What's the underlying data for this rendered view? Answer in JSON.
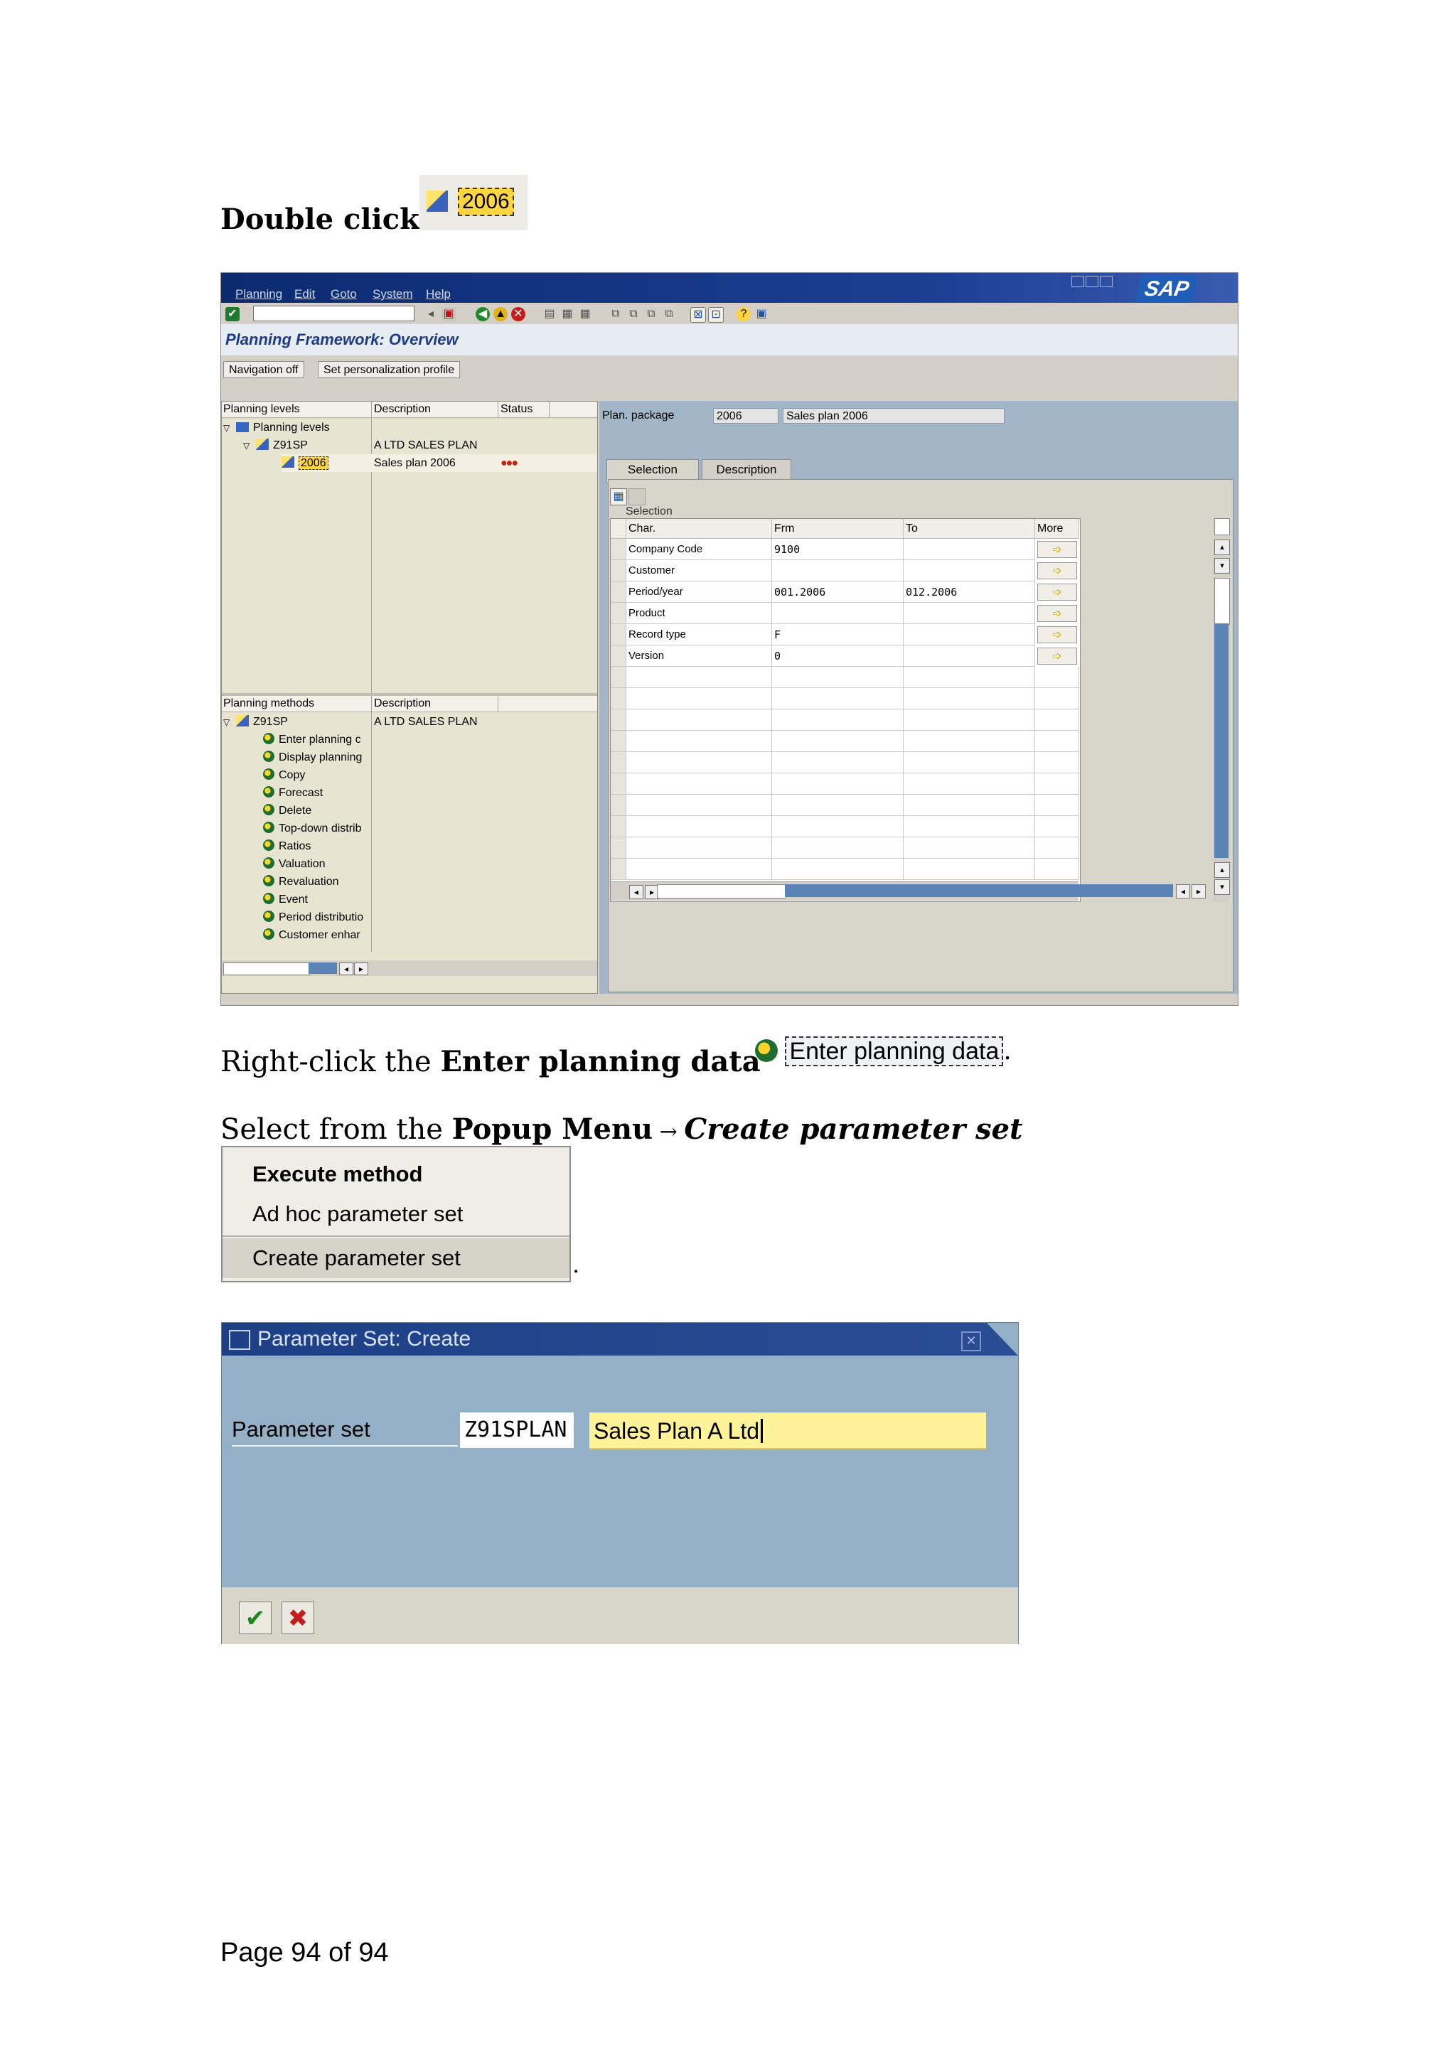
{
  "doc": {
    "step1_lead": "Double click",
    "step1_inline_label": "2006",
    "step2_prefix": "Right-click the ",
    "step2_bold": "Enter planning data",
    "step2_inline_label": "Enter planning data",
    "step2_suffix": ".",
    "step3_prefix": "Select from the ",
    "step3_bold": "Popup Menu",
    "step3_arrow": " → ",
    "step3_bold_italic": "Create parameter set",
    "menu_trailing_dot": ".",
    "footer": "Page 94 of 94"
  },
  "sap": {
    "menu": [
      "Planning",
      "Edit",
      "Goto",
      "System",
      "Help"
    ],
    "logo": "SAP",
    "screen_title": "Planning Framework: Overview",
    "app_buttons": [
      "Navigation off",
      "Set personalization profile"
    ],
    "levels_headers": [
      "Planning levels",
      "Description",
      "Status"
    ],
    "levels_rows": [
      {
        "name": "Planning levels",
        "desc": "",
        "status": ""
      },
      {
        "name": "Z91SP",
        "desc": "A LTD SALES PLAN",
        "status": ""
      },
      {
        "name": "2006",
        "desc": "Sales plan 2006",
        "status": "●●●"
      }
    ],
    "methods_headers": [
      "Planning methods",
      "Description"
    ],
    "methods_root": {
      "name": "Z91SP",
      "desc": "A LTD SALES PLAN"
    },
    "methods": [
      "Enter planning c",
      "Display planning",
      "Copy",
      "Forecast",
      "Delete",
      "Top-down distrib",
      "Ratios",
      "Valuation",
      "Revaluation",
      "Event",
      "Period distributio",
      "Customer enhar"
    ],
    "plan_package_label": "Plan. package",
    "plan_package_value": "2006",
    "plan_package_desc": "Sales plan 2006",
    "tabs": [
      "Selection",
      "Description"
    ],
    "selection_caption": "Selection",
    "grid_headers": [
      "Char.",
      "Frm",
      "To",
      "More"
    ],
    "grid_rows": [
      {
        "char": "Company Code",
        "from": "9100",
        "to": ""
      },
      {
        "char": "Customer",
        "from": "",
        "to": ""
      },
      {
        "char": "Period/year",
        "from": "001.2006",
        "to": "012.2006"
      },
      {
        "char": "Product",
        "from": "",
        "to": ""
      },
      {
        "char": "Record type",
        "from": "F",
        "to": ""
      },
      {
        "char": "Version",
        "from": "0",
        "to": ""
      }
    ]
  },
  "popup_menu": {
    "items": [
      "Execute method",
      "Ad hoc parameter set",
      "Create parameter set"
    ]
  },
  "dialog": {
    "title": "Parameter Set: Create",
    "label": "Parameter set",
    "id_value": "Z91SPLAN",
    "desc_value": "Sales Plan A Ltd"
  }
}
